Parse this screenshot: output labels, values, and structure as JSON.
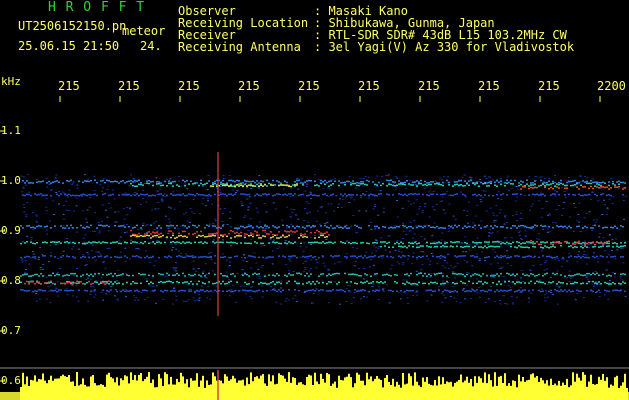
{
  "header": {
    "title": "H R O F F T",
    "file_name": "UT2506152150.pn",
    "file_type": "meteor",
    "date_time": "25.06.15 21:50",
    "date_suffix": "24.",
    "fields": [
      {
        "label": "Observer",
        "value": ": Masaki Kano"
      },
      {
        "label": "Receiving Location",
        "value": ": Shibukawa, Gunma, Japan"
      },
      {
        "label": "Receiver",
        "value": ": RTL-SDR SDR# 43dB L15 103.2MHz CW"
      },
      {
        "label": "Receiving Antenna",
        "value": ": 3el Yagi(V) Az 330 for Vladivostok"
      }
    ]
  },
  "axis": {
    "y_unit": "kHz",
    "x_ticks": [
      "215",
      "215",
      "215",
      "215",
      "215",
      "215",
      "215",
      "215",
      "215",
      "2200"
    ],
    "y_ticks": [
      "1.1",
      "1.0",
      "0.9",
      "0.8",
      "0.7",
      "0.6"
    ]
  },
  "colors": {
    "label": "#ffff66",
    "title": "#2fd52f",
    "background": "#000000"
  }
}
